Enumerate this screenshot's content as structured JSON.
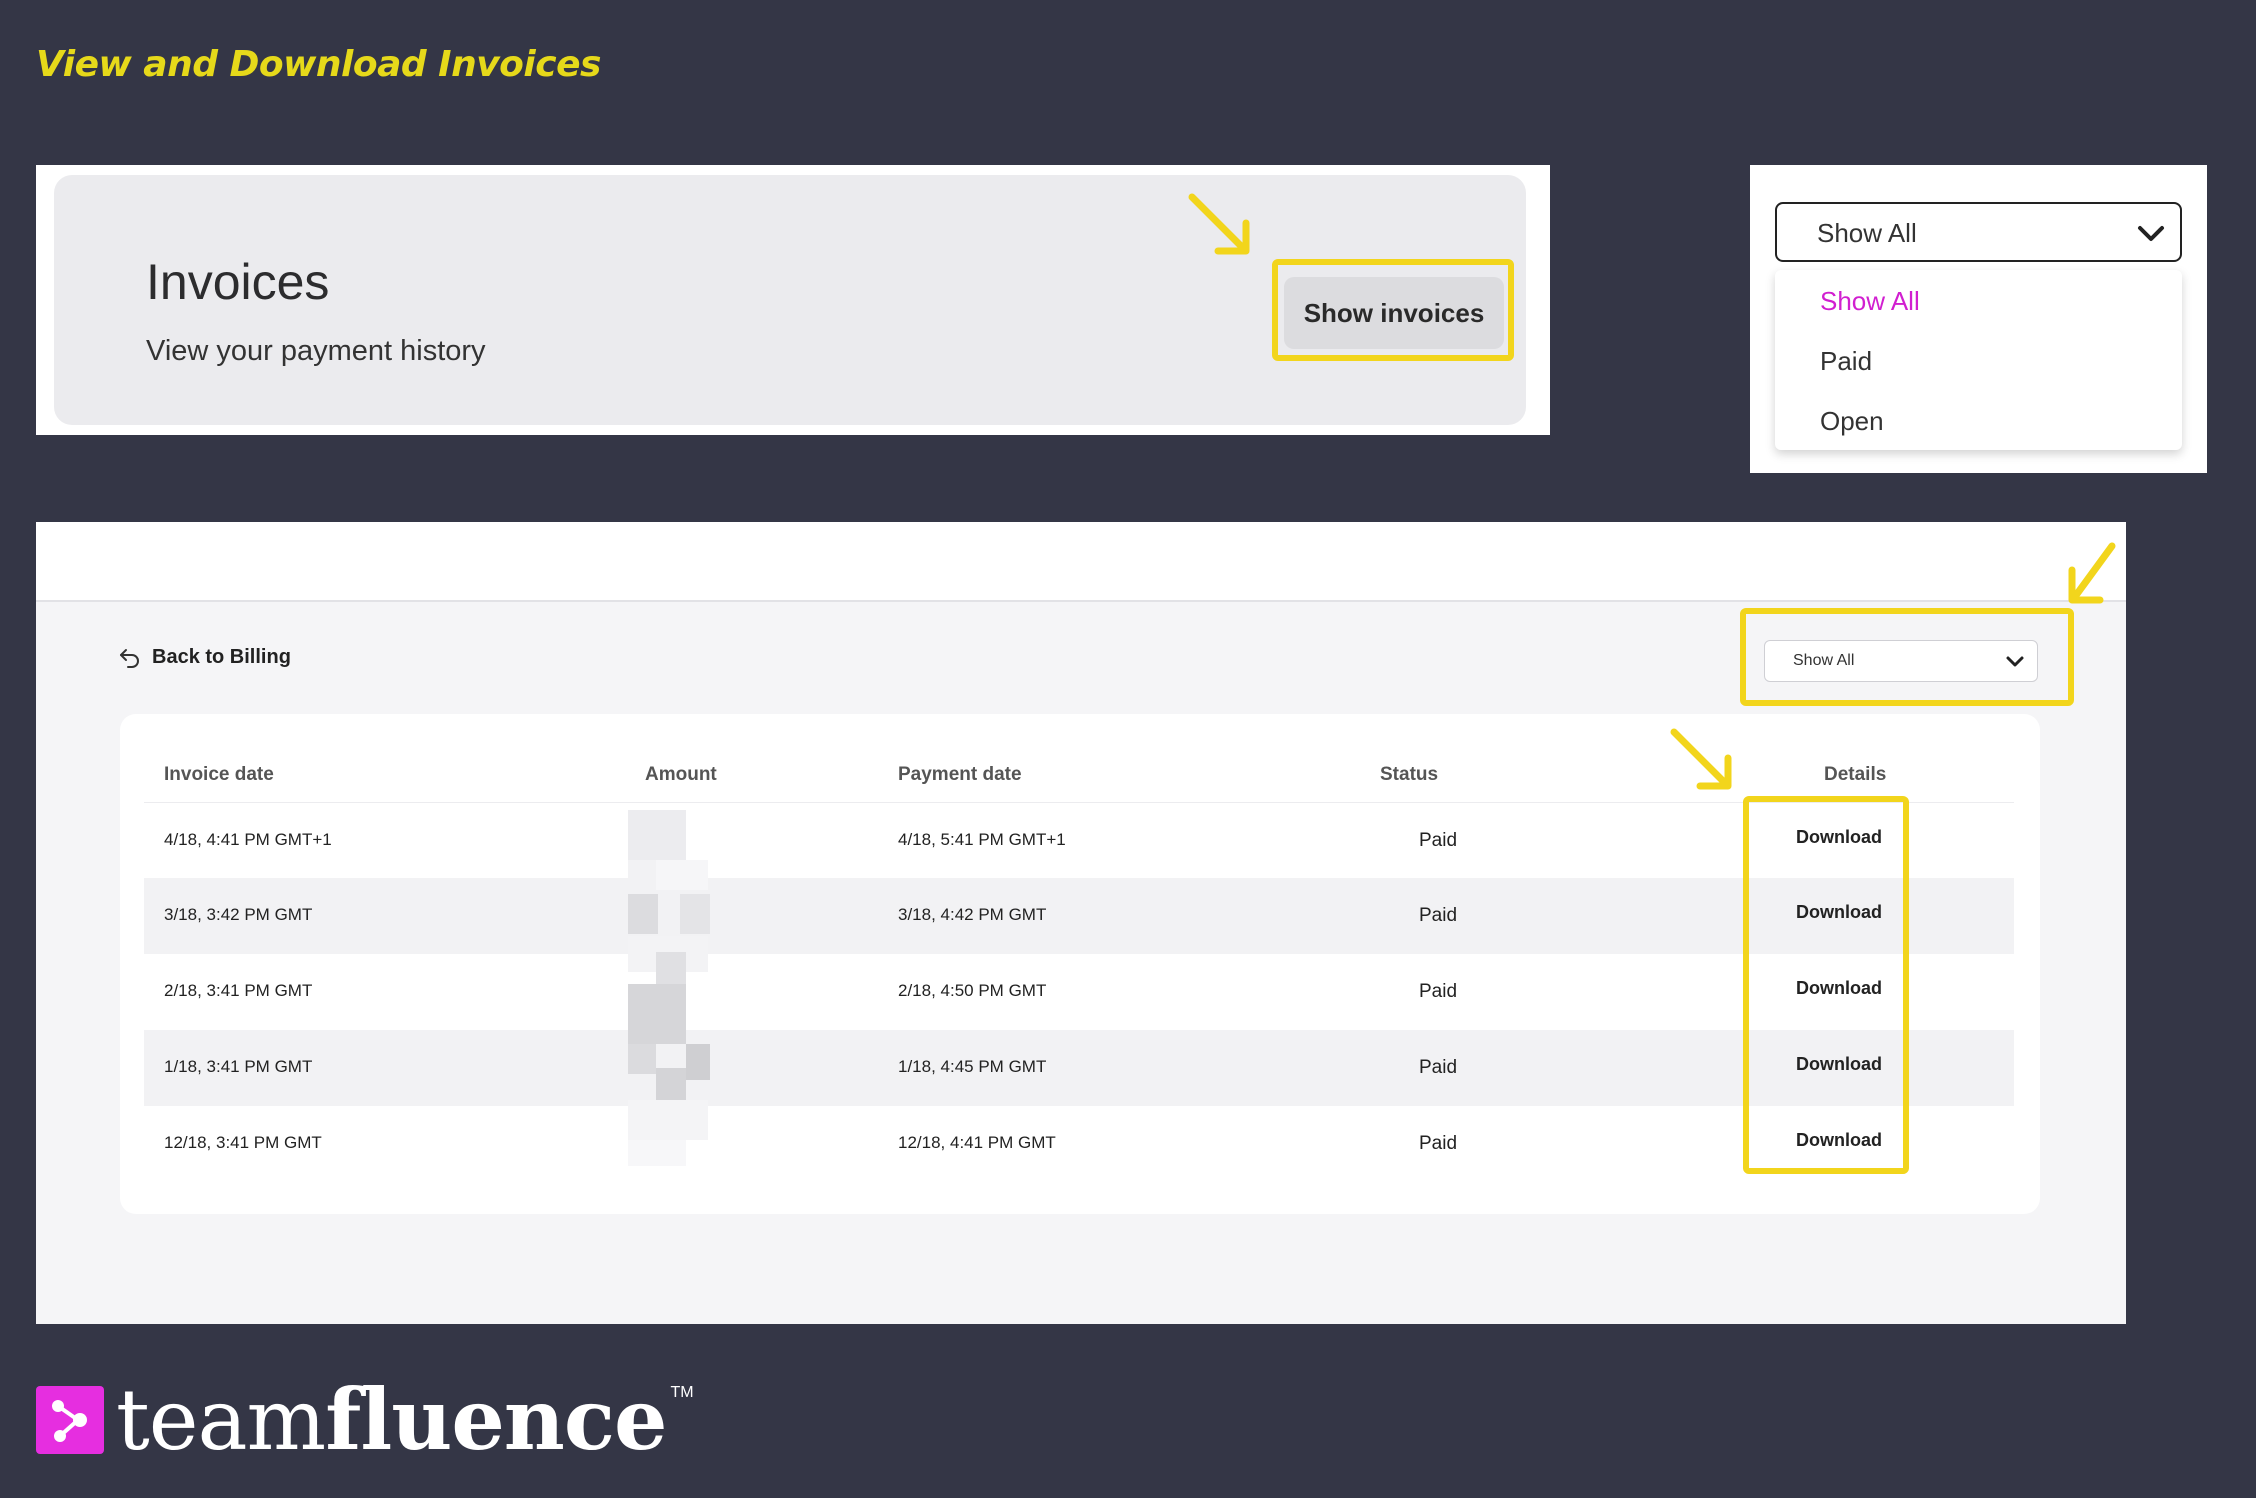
{
  "heading": "View and Download Invoices",
  "invoices_card": {
    "title": "Invoices",
    "subtitle": "View your payment history",
    "show_button": "Show invoices"
  },
  "dropdown": {
    "selected": "Show All",
    "options": [
      {
        "label": "Show All",
        "color": "#d11fd0"
      },
      {
        "label": "Paid"
      },
      {
        "label": "Open"
      }
    ]
  },
  "invoice_list": {
    "back_label": "Back to Billing",
    "filter_selected": "Show All",
    "headers": [
      "Invoice date",
      "Amount",
      "Payment date",
      "Status",
      "Details"
    ],
    "rows": [
      {
        "invoice_date": "4/18, 4:41 PM GMT+1",
        "payment_date": "4/18, 5:41 PM GMT+1",
        "status": "Paid",
        "details": "Download"
      },
      {
        "invoice_date": "3/18, 3:42 PM GMT",
        "payment_date": "3/18, 4:42 PM GMT",
        "status": "Paid",
        "details": "Download"
      },
      {
        "invoice_date": "2/18, 3:41 PM GMT",
        "payment_date": "2/18, 4:50 PM GMT",
        "status": "Paid",
        "details": "Download"
      },
      {
        "invoice_date": "1/18, 3:41 PM GMT",
        "payment_date": "1/18, 4:45 PM GMT",
        "status": "Paid",
        "details": "Download"
      },
      {
        "invoice_date": "12/18, 3:41 PM GMT",
        "payment_date": "12/18, 4:41 PM GMT",
        "status": "Paid",
        "details": "Download"
      }
    ]
  },
  "logo": {
    "text_light": "team",
    "text_bold": "fluence",
    "trademark": "TM"
  },
  "colors": {
    "background": "#343646",
    "highlight": "#f2d51c",
    "heading": "#e6d91a",
    "brand": "#e62ee0"
  },
  "icons": [
    "arrow-pointer-icon",
    "chevron-down-icon",
    "back-arrow-icon",
    "teamfluence-logo-icon"
  ]
}
